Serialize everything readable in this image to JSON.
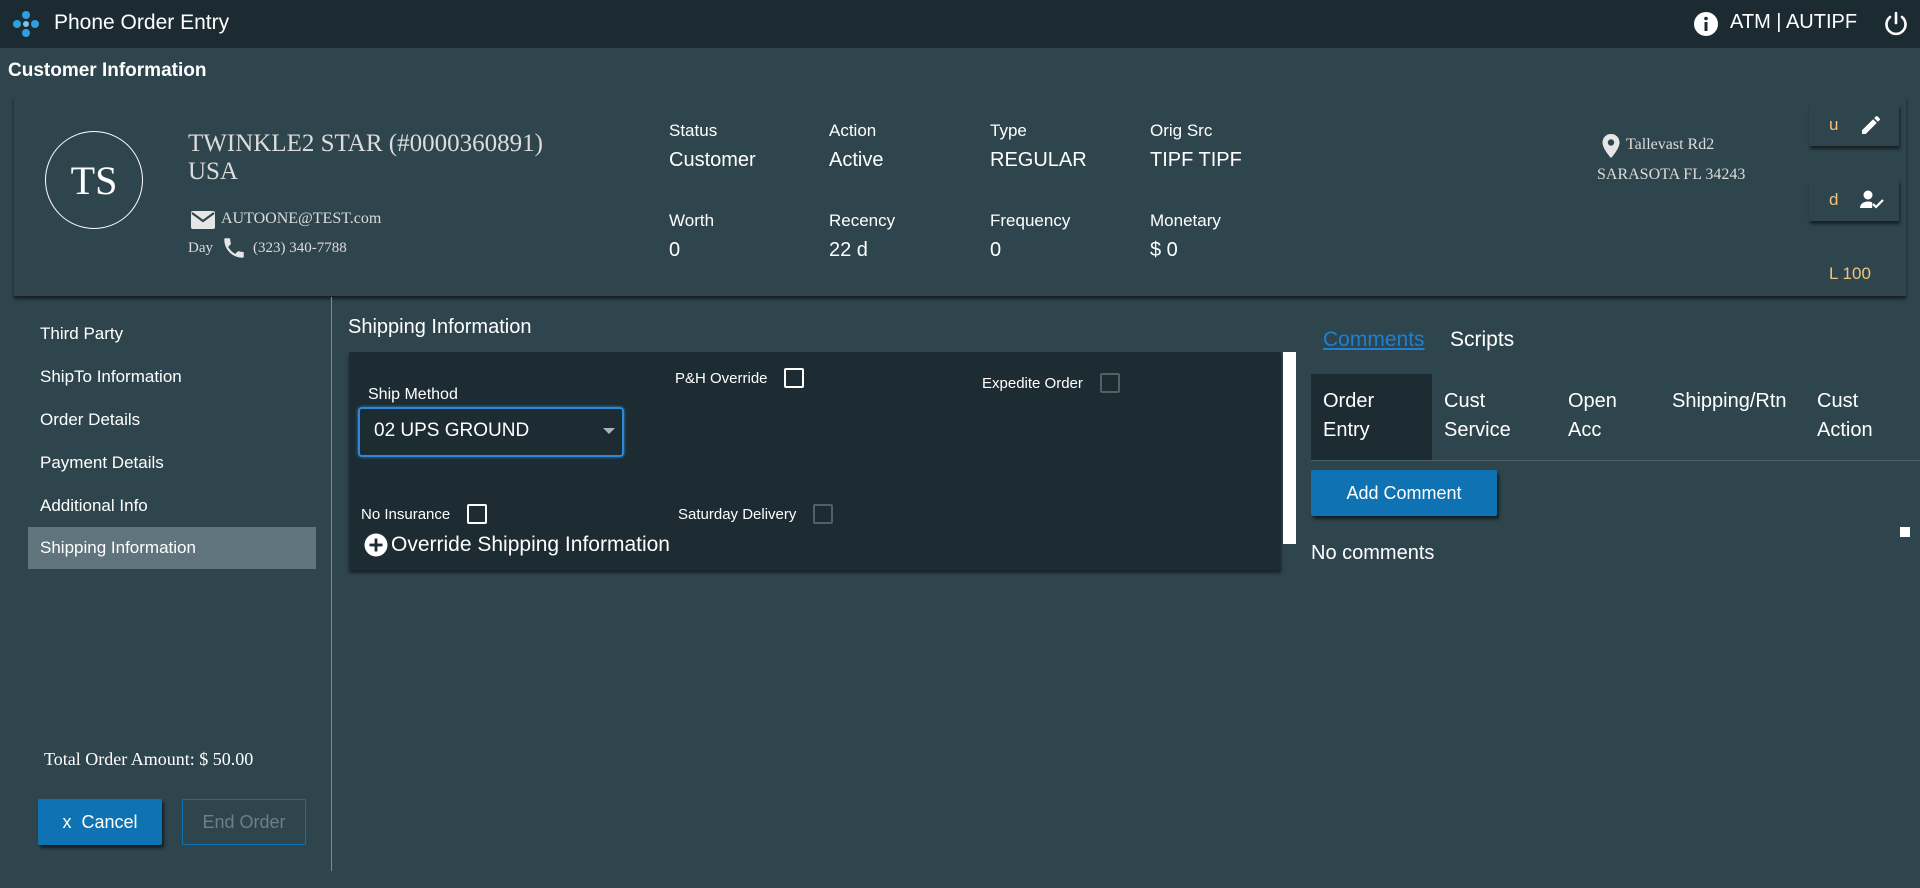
{
  "header": {
    "app_title": "Phone Order Entry",
    "user_label": "ATM | AUTIPF"
  },
  "customer_section": {
    "heading": "Customer Information",
    "initials": "TS",
    "name": "TWINKLE2 STAR (#0000360891)",
    "country": "USA",
    "email": "AUTOONE@TEST.com",
    "phone_label": "Day",
    "phone": "(323) 340-7788",
    "stats": [
      {
        "label": "Status",
        "value": "Customer"
      },
      {
        "label": "Action",
        "value": "Active"
      },
      {
        "label": "Type",
        "value": "REGULAR"
      },
      {
        "label": "Orig Src",
        "value": "TIPF TIPF"
      },
      {
        "label": "Worth",
        "value": "0"
      },
      {
        "label": "Recency",
        "value": "22 d"
      },
      {
        "label": "Frequency",
        "value": "0"
      },
      {
        "label": "Monetary",
        "value": "$ 0"
      }
    ],
    "address_line1": "Tallevast Rd2",
    "address_line2": "SARASOTA FL 34243",
    "edit_button_label": "u",
    "verify_button_label": "d",
    "level_label": "L 100"
  },
  "sidebar": {
    "items": [
      {
        "label": "Third Party"
      },
      {
        "label": "ShipTo Information"
      },
      {
        "label": "Order Details"
      },
      {
        "label": "Payment Details"
      },
      {
        "label": "Additional Info"
      },
      {
        "label": "Shipping Information",
        "active": true
      }
    ],
    "total_order": "Total Order Amount: $ 50.00",
    "cancel_label": "x  Cancel",
    "end_order_label": "End Order"
  },
  "shipping": {
    "heading": "Shipping Information",
    "ship_method_label": "Ship Method",
    "ship_method_value": "02 UPS GROUND",
    "ph_override_label": "P&H Override",
    "expedite_label": "Expedite Order",
    "no_insurance_label": "No Insurance",
    "saturday_label": "Saturday Delivery",
    "override_label": "Override Shipping Information"
  },
  "comments": {
    "tabs": [
      "Comments",
      "Scripts"
    ],
    "subtabs": [
      {
        "line1": "Order",
        "line2": "Entry"
      },
      {
        "line1": "Cust",
        "line2": "Service"
      },
      {
        "line1": "Open",
        "line2": "Acc"
      },
      {
        "line1": "Shipping/Rtn",
        "line2": ""
      },
      {
        "line1": "Cust",
        "line2": "Action"
      }
    ],
    "add_comment_label": "Add Comment",
    "empty_text": "No comments"
  },
  "colors": {
    "background": "#2e454d",
    "topbar": "#1c2b32",
    "panel": "#1d2b32",
    "accent": "#0f72b2",
    "link": "#1f7fd0",
    "badge_text": "#f1c27d"
  }
}
